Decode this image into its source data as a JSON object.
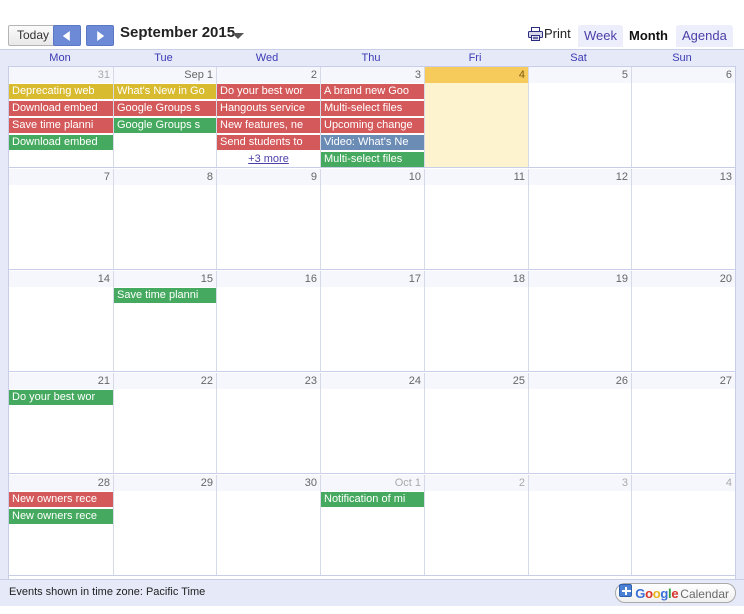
{
  "toolbar": {
    "today_label": "Today",
    "prev_label": "Previous period",
    "next_label": "Next period",
    "period_title": "September 2015",
    "print_label": "Print",
    "tabs": [
      {
        "label": "Week",
        "selected": false
      },
      {
        "label": "Month",
        "selected": true
      },
      {
        "label": "Agenda",
        "selected": false
      }
    ]
  },
  "day_names": [
    "Mon",
    "Tue",
    "Wed",
    "Thu",
    "Fri",
    "Sat",
    "Sun"
  ],
  "colors": {
    "event_yellow": "#d8bb2e",
    "event_red": "#d4595b",
    "event_green": "#45aa5f",
    "event_blue": "#6b8cb5",
    "today_header": "#f7ca5c",
    "today_body": "#fdf3cf",
    "header_band": "#e6e9f8",
    "grid_line": "#c9cee8",
    "link": "#4b3fa8"
  },
  "weeks": [
    {
      "days": [
        {
          "num": "31",
          "other_month": true,
          "today": false,
          "events": [
            {
              "title": "Deprecating web",
              "color": "#d8bb2e"
            },
            {
              "title": "Download embed",
              "color": "#d4595b"
            },
            {
              "title": "Save time planni",
              "color": "#d4595b"
            },
            {
              "title": "Download embed",
              "color": "#45aa5f"
            }
          ],
          "more": null
        },
        {
          "num": "Sep 1",
          "other_month": false,
          "today": false,
          "events": [
            {
              "title": "What's New in Go",
              "color": "#d8bb2e"
            },
            {
              "title": "Google Groups s",
              "color": "#d4595b"
            },
            {
              "title": "Google Groups s",
              "color": "#45aa5f"
            }
          ],
          "more": null
        },
        {
          "num": "2",
          "other_month": false,
          "today": false,
          "events": [
            {
              "title": "Do your best wor",
              "color": "#d4595b"
            },
            {
              "title": "Hangouts service",
              "color": "#d4595b"
            },
            {
              "title": "New features, ne",
              "color": "#d4595b"
            },
            {
              "title": "Send students to",
              "color": "#d4595b"
            }
          ],
          "more": "+3 more"
        },
        {
          "num": "3",
          "other_month": false,
          "today": false,
          "events": [
            {
              "title": "A brand new Goo",
              "color": "#d4595b"
            },
            {
              "title": "Multi-select files",
              "color": "#d4595b"
            },
            {
              "title": "Upcoming change",
              "color": "#d4595b"
            },
            {
              "title": "Video: What's Ne",
              "color": "#6b8cb5"
            },
            {
              "title": "Multi-select files",
              "color": "#45aa5f"
            }
          ],
          "more": null
        },
        {
          "num": "4",
          "other_month": false,
          "today": true,
          "events": [],
          "more": null
        },
        {
          "num": "5",
          "other_month": false,
          "today": false,
          "events": [],
          "more": null
        },
        {
          "num": "6",
          "other_month": false,
          "today": false,
          "events": [],
          "more": null
        }
      ]
    },
    {
      "days": [
        {
          "num": "7",
          "other_month": false,
          "today": false,
          "events": [],
          "more": null
        },
        {
          "num": "8",
          "other_month": false,
          "today": false,
          "events": [],
          "more": null
        },
        {
          "num": "9",
          "other_month": false,
          "today": false,
          "events": [],
          "more": null
        },
        {
          "num": "10",
          "other_month": false,
          "today": false,
          "events": [],
          "more": null
        },
        {
          "num": "11",
          "other_month": false,
          "today": false,
          "events": [],
          "more": null
        },
        {
          "num": "12",
          "other_month": false,
          "today": false,
          "events": [],
          "more": null
        },
        {
          "num": "13",
          "other_month": false,
          "today": false,
          "events": [],
          "more": null
        }
      ]
    },
    {
      "days": [
        {
          "num": "14",
          "other_month": false,
          "today": false,
          "events": [],
          "more": null
        },
        {
          "num": "15",
          "other_month": false,
          "today": false,
          "events": [
            {
              "title": "Save time planni",
              "color": "#45aa5f"
            }
          ],
          "more": null
        },
        {
          "num": "16",
          "other_month": false,
          "today": false,
          "events": [],
          "more": null
        },
        {
          "num": "17",
          "other_month": false,
          "today": false,
          "events": [],
          "more": null
        },
        {
          "num": "18",
          "other_month": false,
          "today": false,
          "events": [],
          "more": null
        },
        {
          "num": "19",
          "other_month": false,
          "today": false,
          "events": [],
          "more": null
        },
        {
          "num": "20",
          "other_month": false,
          "today": false,
          "events": [],
          "more": null
        }
      ]
    },
    {
      "days": [
        {
          "num": "21",
          "other_month": false,
          "today": false,
          "events": [
            {
              "title": "Do your best wor",
              "color": "#45aa5f"
            }
          ],
          "more": null
        },
        {
          "num": "22",
          "other_month": false,
          "today": false,
          "events": [],
          "more": null
        },
        {
          "num": "23",
          "other_month": false,
          "today": false,
          "events": [],
          "more": null
        },
        {
          "num": "24",
          "other_month": false,
          "today": false,
          "events": [],
          "more": null
        },
        {
          "num": "25",
          "other_month": false,
          "today": false,
          "events": [],
          "more": null
        },
        {
          "num": "26",
          "other_month": false,
          "today": false,
          "events": [],
          "more": null
        },
        {
          "num": "27",
          "other_month": false,
          "today": false,
          "events": [],
          "more": null
        }
      ]
    },
    {
      "days": [
        {
          "num": "28",
          "other_month": false,
          "today": false,
          "events": [
            {
              "title": "New owners rece",
              "color": "#d4595b"
            },
            {
              "title": "New owners rece",
              "color": "#45aa5f"
            }
          ],
          "more": null
        },
        {
          "num": "29",
          "other_month": false,
          "today": false,
          "events": [],
          "more": null
        },
        {
          "num": "30",
          "other_month": false,
          "today": false,
          "events": [],
          "more": null
        },
        {
          "num": "Oct 1",
          "other_month": true,
          "today": false,
          "events": [
            {
              "title": "Notification of mi",
              "color": "#45aa5f"
            }
          ],
          "more": null
        },
        {
          "num": "2",
          "other_month": true,
          "today": false,
          "events": [],
          "more": null
        },
        {
          "num": "3",
          "other_month": true,
          "today": false,
          "events": [],
          "more": null
        },
        {
          "num": "4",
          "other_month": true,
          "today": false,
          "events": [],
          "more": null
        }
      ]
    }
  ],
  "footer": {
    "timezone_note": "Events shown in time zone: Pacific Time",
    "badge": {
      "g1": "G",
      "g2": "o",
      "g3": "o",
      "g4": "g",
      "g5": "l",
      "g6": "e",
      "word": "Calendar"
    }
  }
}
